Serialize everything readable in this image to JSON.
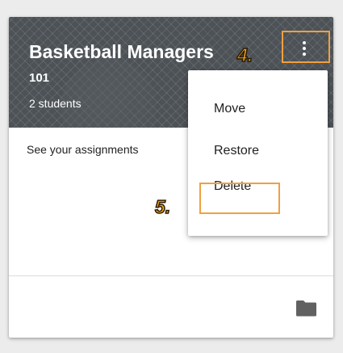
{
  "class_card": {
    "title": "Basketball Managers",
    "section": "101",
    "student_count": "2 students",
    "body_text": "See your assignments"
  },
  "menu": {
    "items": [
      {
        "label": "Move"
      },
      {
        "label": "Restore"
      },
      {
        "label": "Delete"
      }
    ]
  },
  "annotations": {
    "step_4": "4.",
    "step_5": "5."
  },
  "icons": {
    "menu_button": "more-vert-icon",
    "footer": "folder-icon"
  },
  "colors": {
    "highlight": "#f0a040",
    "banner": "#4d5257",
    "step_label": "#f5a623"
  }
}
